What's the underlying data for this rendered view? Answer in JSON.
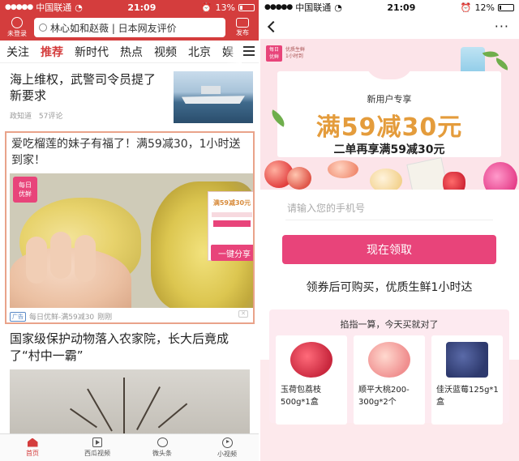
{
  "left": {
    "status": {
      "carrier": "中国联通",
      "time": "21:09",
      "battery": "13%"
    },
    "header": {
      "login_label": "未登录",
      "search_text": "林心如和赵薇 | 日本网友评价",
      "publish_label": "发布"
    },
    "tabs": [
      "关注",
      "推荐",
      "新时代",
      "热点",
      "视频",
      "北京",
      "娱"
    ],
    "active_tab": "推荐",
    "news1": {
      "title": "海上维权，武警司令员提了新要求",
      "source": "政知道",
      "comments": "57评论"
    },
    "ad": {
      "title": "爱吃榴莲的妹子有福了！满59减30，1小时送到家！",
      "badge": "每日\n优鲜",
      "mock_offer": "满59减30元",
      "share_label": "一键分享",
      "tag": "广告",
      "meta": "每日优鲜-满59减30",
      "time": "刚刚"
    },
    "news3": {
      "title": "国家级保护动物落入农家院，长大后竟成了“村中一霸”"
    },
    "bottom_nav": [
      "首页",
      "西瓜视频",
      "微头条",
      "小视频"
    ]
  },
  "right": {
    "status": {
      "carrier": "中国联通",
      "time": "21:09",
      "battery": "12%"
    },
    "nav": {
      "more_label": "···"
    },
    "logo": {
      "mark": "每日\n优鲜",
      "text": "优质生鲜\n1小时到"
    },
    "banner": {
      "subtitle": "新用户专享",
      "headline": "满59减30元",
      "second_line": "二单再享满59减30元"
    },
    "form": {
      "phone_placeholder": "请输入您的手机号",
      "claim_label": "现在领取",
      "note": "领券后可购买，优质生鲜1小时达"
    },
    "calc": {
      "title": "掐指一算，今天买就对了",
      "products": [
        {
          "name": "玉荷包荔枝500g*1盒",
          "color": "#c9283e"
        },
        {
          "name": "顺平大桃200-300g*2个",
          "color": "#f08f8f"
        },
        {
          "name": "佳沃蓝莓125g*1盒",
          "color": "#2e3a6e"
        }
      ]
    }
  },
  "colors": {
    "brand_red": "#d43d3d",
    "pink": "#e8447a",
    "gold": "#e49c3c"
  }
}
